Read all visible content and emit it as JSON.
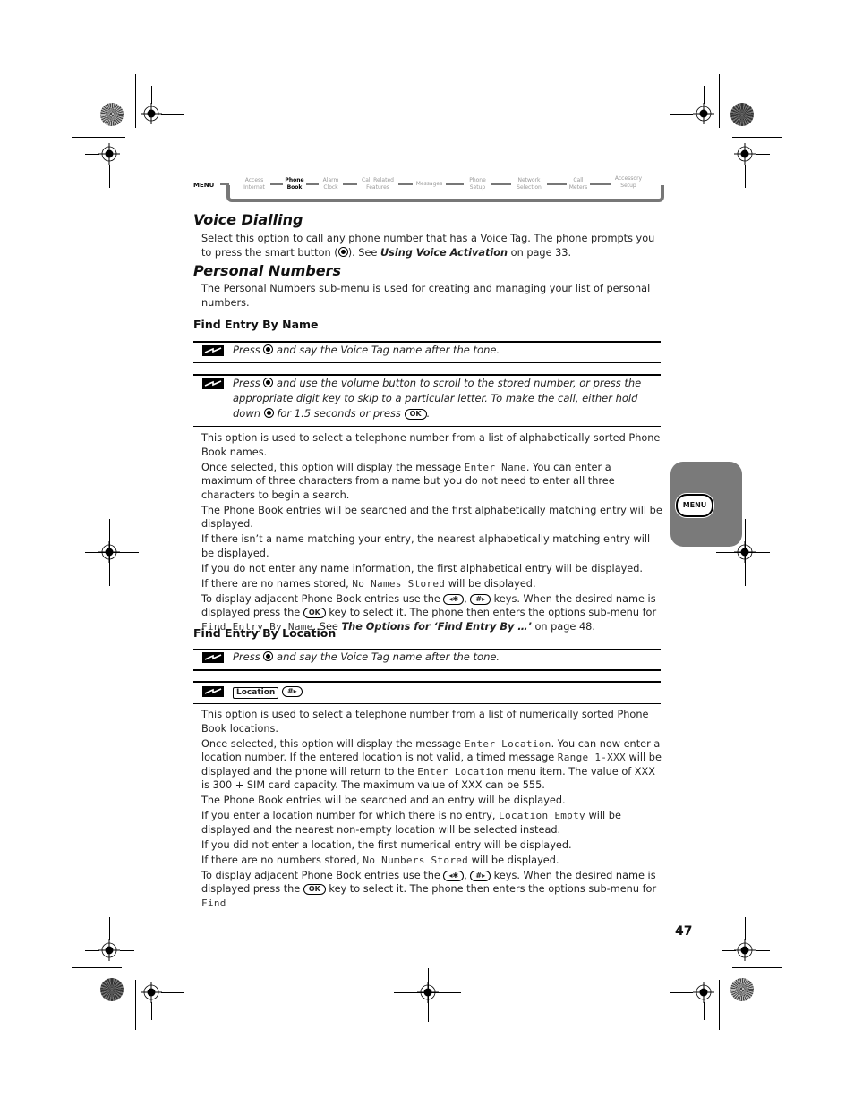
{
  "menu_nav": {
    "menu_label": "MENU",
    "items": [
      {
        "line1": "Access",
        "line2": "Internet",
        "active": false
      },
      {
        "line1": "Phone",
        "line2": "Book",
        "active": true
      },
      {
        "line1": "Alarm",
        "line2": "Clock",
        "active": false
      },
      {
        "line1": "Call Related",
        "line2": "Features",
        "active": false
      },
      {
        "line1": "Messages",
        "line2": "",
        "active": false
      },
      {
        "line1": "Phone",
        "line2": "Setup",
        "active": false
      },
      {
        "line1": "Network",
        "line2": "Selection",
        "active": false
      },
      {
        "line1": "Call",
        "line2": "Meters",
        "active": false
      },
      {
        "line1": "Accessory",
        "line2": "Setup",
        "active": false
      }
    ]
  },
  "sections": {
    "voice_dialling": {
      "title": "Voice Dialling",
      "text_a": "Select this option to call any phone number that has a Voice Tag. The phone prompts you to press the smart button (",
      "text_b": "). See ",
      "link": "Using Voice Activation",
      "text_c": " on page 33."
    },
    "personal_numbers": {
      "title": "Personal Numbers",
      "text": "The Personal Numbers sub-menu is used for creating and managing your list of personal numbers."
    },
    "find_by_name": {
      "title": "Find Entry By Name",
      "tip1_a": "Press ",
      "tip1_b": " and say the Voice Tag name after the tone.",
      "tip2_a": "Press ",
      "tip2_b": " and use the volume button to scroll to the stored number, or press the appropriate digit key to skip to a particular letter. To make the call, either hold down ",
      "tip2_c": " for 1.5 seconds or press ",
      "tip2_d": ".",
      "ok_key": "OK",
      "p1": "This option is used to select a telephone number from a list of alphabetically sorted Phone Book names.",
      "p2_a": "Once selected, this option will display the message ",
      "p2_lcd": "Enter Name",
      "p2_b": ". You can enter a maximum of three characters from a name but you do not need to enter all three characters to begin a search.",
      "p3": "The Phone Book entries will be searched and the first alphabetically matching entry will be displayed.",
      "p4": "If there isn’t a name matching your entry, the nearest alphabetically matching entry will be displayed.",
      "p5": "If you do not enter any name information, the first alphabetical entry will be displayed.",
      "p6_a": "If there are no names stored, ",
      "p6_lcd": "No Names Stored",
      "p6_b": " will be displayed.",
      "p7_a": "To display adjacent Phone Book entries use the ",
      "key_star": "◂✱",
      "key_hash": "#▸",
      "p7_b": " keys. When the desired name is displayed press the ",
      "p7_c": " key to select it. The phone then enters the options sub-menu for ",
      "p7_lcd": "Find Entry By Name",
      "p7_d": ". See ",
      "p7_link": "The Options for ‘Find Entry By …’",
      "p7_e": " on page 48."
    },
    "find_by_location": {
      "title": "Find Entry By Location",
      "tip1_a": "Press ",
      "tip1_b": " and say the Voice Tag name after the tone.",
      "softkey": "Location",
      "key_hash": "#▸",
      "p1": "This option is used to select a telephone number from a list of numerically sorted Phone Book locations.",
      "p2_a": "Once selected, this option will display the message ",
      "p2_lcd1": "Enter Location",
      "p2_b": ". You can now enter a location number. If the entered location is not valid, a timed message ",
      "p2_lcd2": "Range 1-XXX",
      "p2_c": " will be displayed and the phone will return to the ",
      "p2_lcd3": "Enter Location",
      "p2_d": " menu item. The value of XXX is 300 + SIM card capacity. The maximum value of XXX can be 555.",
      "p3": "The Phone Book entries will be searched and an entry will be displayed.",
      "p4_a": "If you enter a location number for which there is no entry, ",
      "p4_lcd": "Location Empty",
      "p4_b": " will be displayed and the nearest non-empty location will be selected instead.",
      "p5": "If you did not enter a location, the first numerical entry will be displayed.",
      "p6_a": "If there are no numbers stored, ",
      "p6_lcd": "No Numbers Stored",
      "p6_b": " will be displayed.",
      "p7_a": "To display adjacent Phone Book entries use the ",
      "key_star": "◂✱",
      "p7_b": " keys. When the desired name is displayed press the ",
      "ok_key": "OK",
      "p7_c": " key to select it. The phone then enters the options sub-menu for ",
      "p7_lcd": "Find"
    }
  },
  "side_tab": {
    "button_label": "MENU",
    "color": "#7a7a7a"
  },
  "page_number": "47"
}
